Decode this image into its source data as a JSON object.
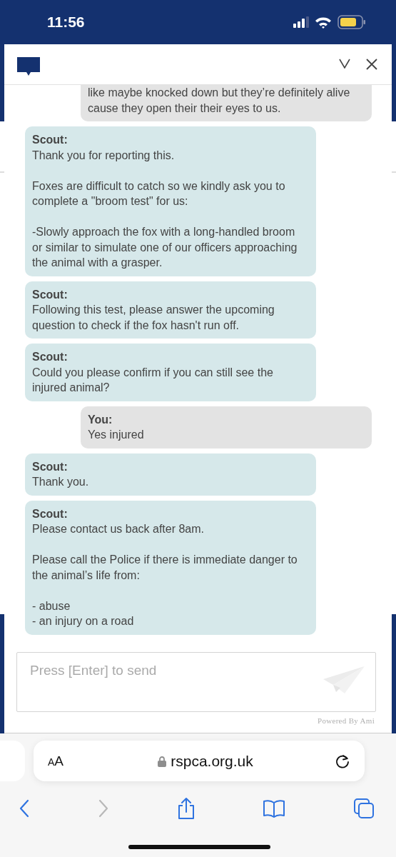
{
  "status_bar": {
    "time": "11:56"
  },
  "chat": {
    "messages": [
      {
        "kind": "user",
        "paragraphs": [
          "like maybe knocked down but they’re definitely alive cause they open their their eyes to us."
        ],
        "clipped_top": true
      },
      {
        "kind": "bot",
        "sender": "Scout:",
        "paragraphs": [
          "Thank you for reporting this.",
          "Foxes are difficult to catch so we kindly ask you to complete a \"broom test\" for us:",
          "-Slowly approach the fox with a long-handled broom or similar to simulate one of our officers approaching the animal with a grasper."
        ]
      },
      {
        "kind": "bot",
        "sender": "Scout:",
        "paragraphs": [
          "Following this test, please answer the upcoming question to check if the fox hasn't run off."
        ]
      },
      {
        "kind": "bot",
        "sender": "Scout:",
        "paragraphs": [
          "Could you please confirm if you can still see the injured animal?"
        ]
      },
      {
        "kind": "user",
        "sender": "You:",
        "paragraphs": [
          "Yes injured"
        ]
      },
      {
        "kind": "bot",
        "sender": "Scout:",
        "paragraphs": [
          "Thank you."
        ]
      },
      {
        "kind": "bot",
        "sender": "Scout:",
        "paragraphs": [
          "Please contact us back after 8am.",
          "Please call the Police if there is immediate danger to the animal’s life from:",
          "- abuse\n- an injury on a road"
        ]
      }
    ],
    "input": {
      "placeholder": "Press [Enter] to send"
    },
    "footer": "Powered By Ami"
  },
  "browser": {
    "text_size": "AA",
    "url": "rspca.org.uk",
    "toolbar": [
      {
        "kind": "back",
        "disabled": false
      },
      {
        "kind": "forward",
        "disabled": true
      },
      {
        "kind": "share",
        "disabled": false
      },
      {
        "kind": "bookmarks",
        "disabled": false
      },
      {
        "kind": "tabs",
        "disabled": false
      }
    ]
  }
}
